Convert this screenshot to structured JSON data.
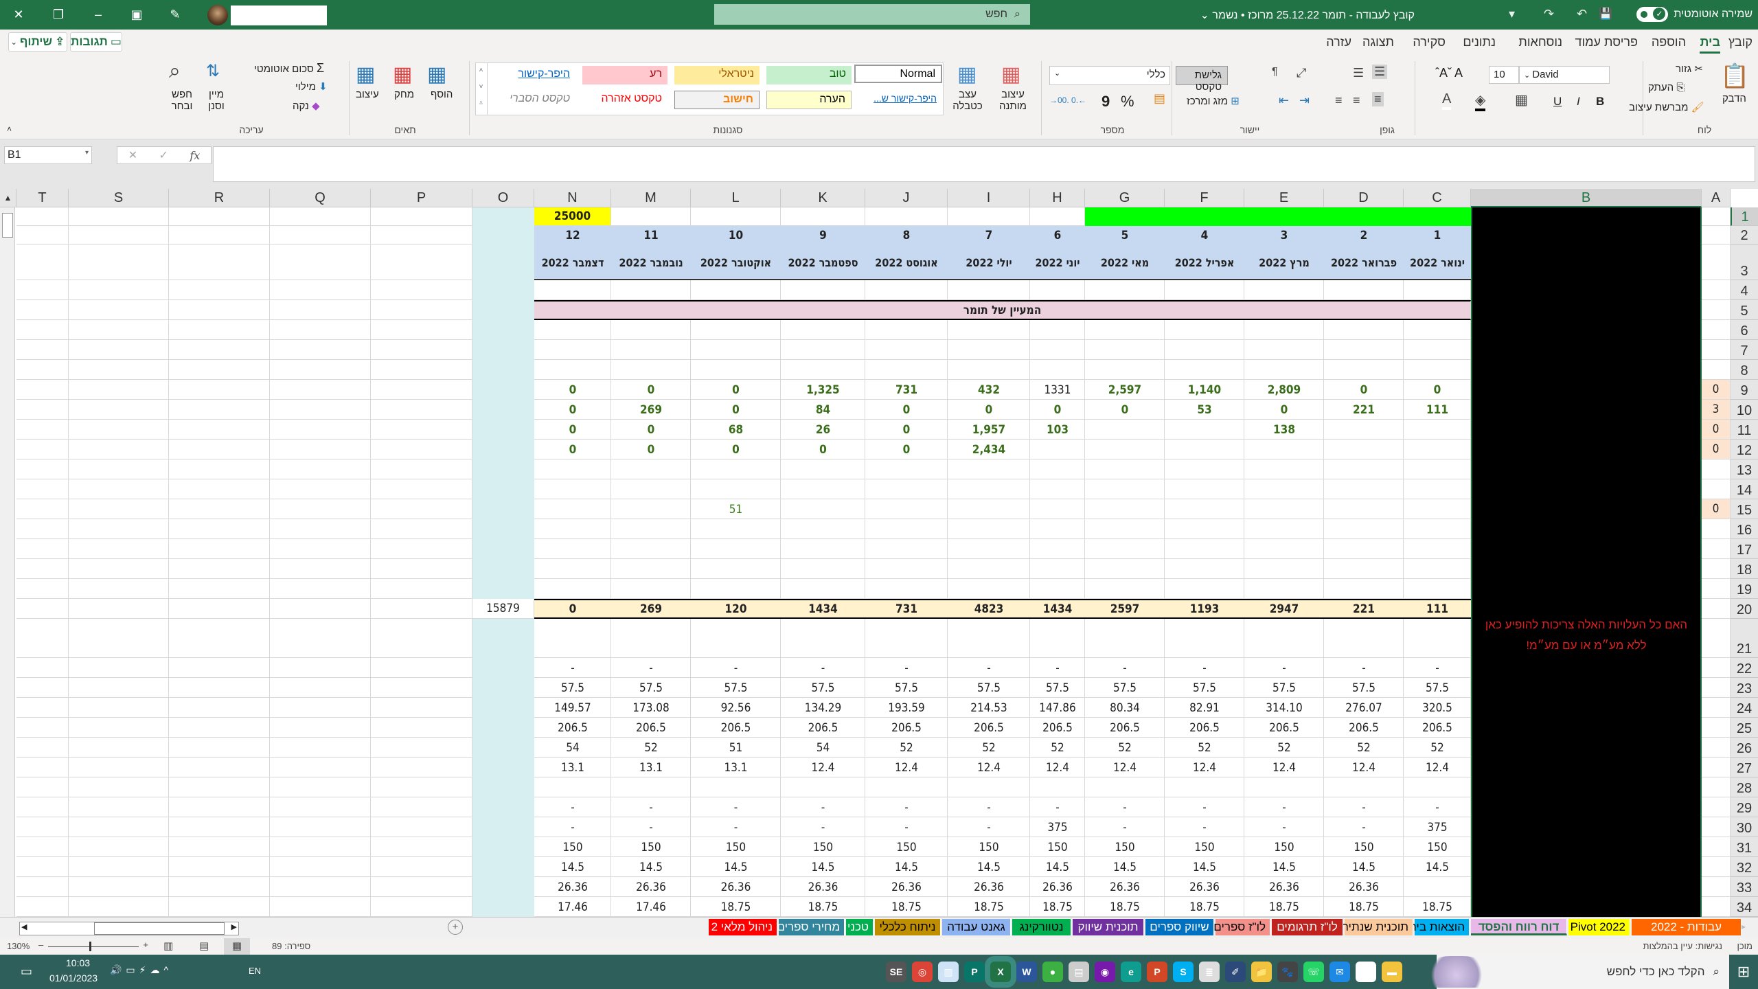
{
  "titlebar": {
    "doc_title": "קובץ לעבודה - תומר 25.12.22 מרוכז • נשמר ⌄",
    "search_placeholder": "חפש",
    "autosave_label": "שמירה אוטומטית",
    "icons": {
      "close": "✕",
      "restore": "❐",
      "minimize": "–",
      "ribbon_display": "▣",
      "pen": "✎",
      "undo": "↶",
      "redo": "↷",
      "save": "💾",
      "customize": "▾"
    }
  },
  "menu": {
    "items": [
      "קובץ",
      "בית",
      "הוספה",
      "פריסת עמוד",
      "נוסחאות",
      "נתונים",
      "סקירה",
      "תצוגה",
      "עזרה"
    ],
    "active": "בית",
    "share": "שיתוף",
    "comments": "תגובות"
  },
  "ribbon": {
    "clipboard": {
      "label": "לוח",
      "paste": "הדבק",
      "cut": "גזור",
      "copy": "העתק",
      "format_painter": "מברשת עיצוב"
    },
    "font": {
      "label": "גופן",
      "name": "David",
      "size": "10",
      "bold": "B",
      "italic": "I",
      "underline": "U"
    },
    "alignment": {
      "label": "יישור",
      "wrap": "גלישת טקסט",
      "merge": "מזג ומרכז"
    },
    "number": {
      "label": "מספר",
      "format": "כללי",
      "percent": "%",
      "comma": "9"
    },
    "styles": {
      "label": "סגנונות",
      "conditional": "עיצוב מותנה",
      "format_table": "עצב כטבלה",
      "cells": [
        {
          "text": "Normal",
          "bg": "#ffffff",
          "color": "#000000"
        },
        {
          "text": "טוב",
          "bg": "#c6efce",
          "color": "#006100"
        },
        {
          "text": "ניטראלי",
          "bg": "#ffeb9c",
          "color": "#9c5700"
        },
        {
          "text": "רע",
          "bg": "#ffc7ce",
          "color": "#9c0006"
        },
        {
          "text": "היפר-קישור",
          "bg": "#ffffff",
          "color": "#0563c1"
        },
        {
          "text": "היפר-קישור ש...",
          "bg": "#ffffff",
          "color": "#0563c1"
        },
        {
          "text": "הערה",
          "bg": "#ffffcc",
          "color": "#000000"
        },
        {
          "text": "חישוב",
          "bg": "#f2f2f2",
          "color": "#fa7d00"
        },
        {
          "text": "טקסט אזהרה",
          "bg": "#ffffff",
          "color": "#ff0000"
        },
        {
          "text": "טקסט הסברי",
          "bg": "#ffffff",
          "color": "#7f7f7f"
        }
      ]
    },
    "cells": {
      "label": "תאים",
      "insert": "הוסף",
      "delete": "מחק",
      "format": "עיצוב"
    },
    "editing": {
      "label": "עריכה",
      "autosum": "סכום אוטומטי",
      "fill": "מילוי",
      "clear": "נקה",
      "sort": "מיין וסנן",
      "find": "חפש ובחר"
    }
  },
  "formula_bar": {
    "name_box": "B1",
    "formula": ""
  },
  "sheet": {
    "columns": [
      "A",
      "B",
      "C",
      "D",
      "E",
      "F",
      "G",
      "H",
      "I",
      "J",
      "K",
      "L",
      "M",
      "N",
      "O",
      "P",
      "Q",
      "R",
      "S",
      "T"
    ],
    "selected_column": "B",
    "rows": [
      "1",
      "2",
      "3",
      "4",
      "5",
      "6",
      "7",
      "8",
      "9",
      "10",
      "11",
      "12",
      "13",
      "14",
      "15",
      "16",
      "17",
      "18",
      "19",
      "20",
      "21",
      "22",
      "23",
      "24",
      "25",
      "26",
      "27",
      "28",
      "29",
      "30",
      "31",
      "32",
      "33",
      "34"
    ],
    "selected_row": "1",
    "n1_value": "25000",
    "month_numbers": [
      "1",
      "2",
      "3",
      "4",
      "5",
      "6",
      "7",
      "8",
      "9",
      "10",
      "11",
      "12"
    ],
    "month_names": [
      "ינואר 2022",
      "פברואר 2022",
      "מרץ 2022",
      "אפריל 2022",
      "מאי 2022",
      "יוני 2022",
      "יולי 2022",
      "אוגוסט 2022",
      "ספטמבר 2022",
      "אוקטובר 2022",
      "נובמבר 2022",
      "דצמבר 2022"
    ],
    "section_title": "המעיין של תומר",
    "a_column": {
      "9": "0",
      "10": "3",
      "11": "0",
      "12": "0",
      "15": "0"
    },
    "data_rows": {
      "9": [
        "0",
        "0",
        "2,809",
        "1,140",
        "2,597",
        "1331",
        "432",
        "731",
        "1,325",
        "0",
        "0",
        "0"
      ],
      "10": [
        "111",
        "221",
        "0",
        "53",
        "0",
        "0",
        "0",
        "0",
        "84",
        "0",
        "269",
        "0"
      ],
      "11": [
        "",
        "",
        "138",
        "",
        "",
        "103",
        "1,957",
        "0",
        "26",
        "68",
        "0",
        "0"
      ],
      "12": [
        "",
        "",
        "",
        "",
        "",
        "",
        "2,434",
        "0",
        "0",
        "0",
        "0",
        "0"
      ],
      "15": [
        "",
        "",
        "",
        "",
        "",
        "",
        "",
        "",
        "",
        "51",
        "",
        ""
      ],
      "20": [
        "111",
        "221",
        "2947",
        "1193",
        "2597",
        "1434",
        "4823",
        "731",
        "1434",
        "120",
        "269",
        "0"
      ],
      "22": [
        "-",
        "-",
        "-",
        "-",
        "-",
        "-",
        "-",
        "-",
        "-",
        "-",
        "-",
        "-"
      ],
      "23": [
        "57.5",
        "57.5",
        "57.5",
        "57.5",
        "57.5",
        "57.5",
        "57.5",
        "57.5",
        "57.5",
        "57.5",
        "57.5",
        "57.5"
      ],
      "24": [
        "320.5",
        "276.07",
        "314.10",
        "82.91",
        "80.34",
        "147.86",
        "214.53",
        "193.59",
        "134.29",
        "92.56",
        "173.08",
        "149.57"
      ],
      "25": [
        "206.5",
        "206.5",
        "206.5",
        "206.5",
        "206.5",
        "206.5",
        "206.5",
        "206.5",
        "206.5",
        "206.5",
        "206.5",
        "206.5"
      ],
      "26": [
        "52",
        "52",
        "52",
        "52",
        "52",
        "52",
        "52",
        "52",
        "54",
        "51",
        "52",
        "54"
      ],
      "27": [
        "12.4",
        "12.4",
        "12.4",
        "12.4",
        "12.4",
        "12.4",
        "12.4",
        "12.4",
        "12.4",
        "13.1",
        "13.1",
        "13.1"
      ],
      "29": [
        "-",
        "-",
        "-",
        "-",
        "-",
        "-",
        "-",
        "-",
        "-",
        "-",
        "-",
        "-"
      ],
      "30": [
        "375",
        "-",
        "-",
        "-",
        "-",
        "375",
        "-",
        "-",
        "-",
        "-",
        "-",
        "-"
      ],
      "31": [
        "150",
        "150",
        "150",
        "150",
        "150",
        "150",
        "150",
        "150",
        "150",
        "150",
        "150",
        "150"
      ],
      "32": [
        "14.5",
        "14.5",
        "14.5",
        "14.5",
        "14.5",
        "14.5",
        "14.5",
        "14.5",
        "14.5",
        "14.5",
        "14.5",
        "14.5"
      ],
      "33": [
        "",
        "26.36",
        "26.36",
        "26.36",
        "26.36",
        "26.36",
        "26.36",
        "26.36",
        "26.36",
        "26.36",
        "26.36",
        "26.36"
      ],
      "34": [
        "18.75",
        "18.75",
        "18.75",
        "18.75",
        "18.75",
        "18.75",
        "18.75",
        "18.75",
        "18.75",
        "18.75",
        "17.46",
        "17.46"
      ]
    },
    "o20_total": "15879",
    "b_note": "האם כל העלויות האלה צריכות להופיע כאן ללא מע״מ או עם מע״מ!"
  },
  "sheet_tabs": [
    {
      "name": "עבודות - 2022",
      "bg": "#ff6600",
      "color": "#ffffff"
    },
    {
      "name": "Pivot 2022",
      "bg": "#ffff00",
      "color": "#000000"
    },
    {
      "name": "דוח רווח והפסד",
      "bg": "#e8b8e8",
      "color": "#217346",
      "active": true
    },
    {
      "name": "הוצאות ביתי",
      "bg": "#00b0f0",
      "color": "#000000"
    },
    {
      "name": "תוכנית שנתית",
      "bg": "#fcc99c",
      "color": "#000000"
    },
    {
      "name": "לו\"ז תרגומים",
      "bg": "#c0221e",
      "color": "#ffffff"
    },
    {
      "name": "לו\"ז ספרים",
      "bg": "#f4908a",
      "color": "#000000"
    },
    {
      "name": "שיווק ספרים",
      "bg": "#0070c0",
      "color": "#ffffff"
    },
    {
      "name": "תוכנית שיווק",
      "bg": "#7030a0",
      "color": "#ffffff"
    },
    {
      "name": "נטוורקינג",
      "bg": "#00b050",
      "color": "#000000"
    },
    {
      "name": "גאנט עבודה",
      "bg": "#8db4f0",
      "color": "#000000"
    },
    {
      "name": "ניתוח כלכלי",
      "bg": "#bf8f00",
      "color": "#000000"
    },
    {
      "name": "טכני",
      "bg": "#00b050",
      "color": "#ffffff"
    },
    {
      "name": "מחירי ספרים",
      "bg": "#31859c",
      "color": "#ffffff"
    },
    {
      "name": "ניהול מלאי 2",
      "bg": "#ff0000",
      "color": "#ffffff"
    }
  ],
  "statusbar": {
    "ready": "מוכן",
    "accessibility": "נגישות: עיין בהמלצות",
    "count": "ספירה: 89",
    "zoom": "130%"
  },
  "taskbar": {
    "search_placeholder": "הקלד כאן כדי לחפש",
    "time": "10:03",
    "date": "01/01/2023",
    "lang": "EN",
    "apps": [
      {
        "name": "file-explorer",
        "bg": "#f2c43d",
        "glyph": "▬"
      },
      {
        "name": "store",
        "bg": "#ffffff",
        "glyph": "▦"
      },
      {
        "name": "mail",
        "bg": "#1e88e5",
        "glyph": "✉"
      },
      {
        "name": "whatsapp",
        "bg": "#25d366",
        "glyph": "☏"
      },
      {
        "name": "cat-app",
        "bg": "#444444",
        "glyph": "🐾"
      },
      {
        "name": "folder",
        "bg": "#f2c43d",
        "glyph": "📁"
      },
      {
        "name": "pen-app",
        "bg": "#2b4a7a",
        "glyph": "✐"
      },
      {
        "name": "notepad",
        "bg": "#dddddd",
        "glyph": "≣"
      },
      {
        "name": "skype",
        "bg": "#00aff0",
        "glyph": "S"
      },
      {
        "name": "powerpoint",
        "bg": "#d24726",
        "glyph": "P"
      },
      {
        "name": "edge",
        "bg": "#0f9d8f",
        "glyph": "e"
      },
      {
        "name": "onenote-app",
        "bg": "#7719aa",
        "glyph": "◉"
      },
      {
        "name": "outlook-app",
        "bg": "#cccccc",
        "glyph": "▤"
      },
      {
        "name": "green-app",
        "bg": "#3cb043",
        "glyph": "●"
      },
      {
        "name": "word",
        "bg": "#2b579a",
        "glyph": "W"
      },
      {
        "name": "excel",
        "bg": "#217346",
        "glyph": "X"
      },
      {
        "name": "publisher",
        "bg": "#077568",
        "glyph": "P"
      },
      {
        "name": "notes-app",
        "bg": "#cfe3f7",
        "glyph": "▥"
      },
      {
        "name": "chrome",
        "bg": "#db4437",
        "glyph": "◎"
      },
      {
        "name": "se-app",
        "bg": "#555555",
        "glyph": "SE"
      }
    ]
  }
}
